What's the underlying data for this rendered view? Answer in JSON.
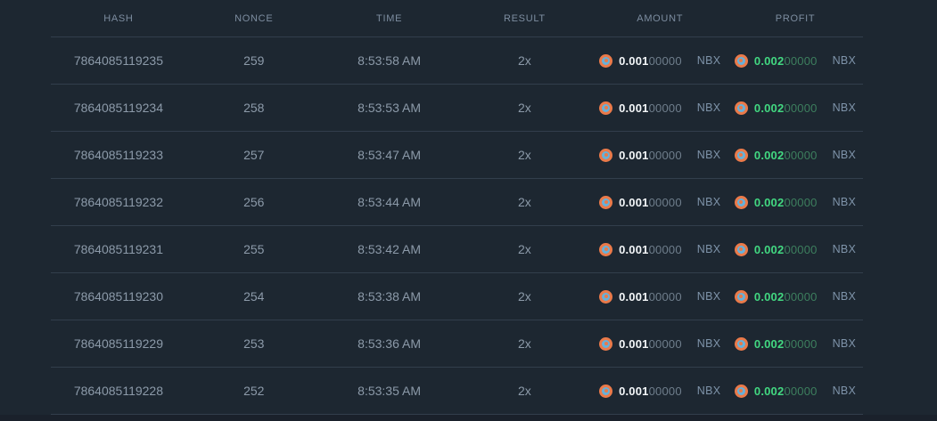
{
  "table": {
    "columns": [
      "HASH",
      "NONCE",
      "TIME",
      "RESULT",
      "AMOUNT",
      "PROFIT"
    ],
    "rows": [
      {
        "hash": "7864085119235",
        "nonce": "259",
        "time": "8:53:58 AM",
        "result": "2x",
        "amount_main": "0.001",
        "amount_rest": "00000",
        "amount_currency": "NBX",
        "profit_main": "0.002",
        "profit_rest": "00000",
        "profit_currency": "NBX"
      },
      {
        "hash": "7864085119234",
        "nonce": "258",
        "time": "8:53:53 AM",
        "result": "2x",
        "amount_main": "0.001",
        "amount_rest": "00000",
        "amount_currency": "NBX",
        "profit_main": "0.002",
        "profit_rest": "00000",
        "profit_currency": "NBX"
      },
      {
        "hash": "7864085119233",
        "nonce": "257",
        "time": "8:53:47 AM",
        "result": "2x",
        "amount_main": "0.001",
        "amount_rest": "00000",
        "amount_currency": "NBX",
        "profit_main": "0.002",
        "profit_rest": "00000",
        "profit_currency": "NBX"
      },
      {
        "hash": "7864085119232",
        "nonce": "256",
        "time": "8:53:44 AM",
        "result": "2x",
        "amount_main": "0.001",
        "amount_rest": "00000",
        "amount_currency": "NBX",
        "profit_main": "0.002",
        "profit_rest": "00000",
        "profit_currency": "NBX"
      },
      {
        "hash": "7864085119231",
        "nonce": "255",
        "time": "8:53:42 AM",
        "result": "2x",
        "amount_main": "0.001",
        "amount_rest": "00000",
        "amount_currency": "NBX",
        "profit_main": "0.002",
        "profit_rest": "00000",
        "profit_currency": "NBX"
      },
      {
        "hash": "7864085119230",
        "nonce": "254",
        "time": "8:53:38 AM",
        "result": "2x",
        "amount_main": "0.001",
        "amount_rest": "00000",
        "amount_currency": "NBX",
        "profit_main": "0.002",
        "profit_rest": "00000",
        "profit_currency": "NBX"
      },
      {
        "hash": "7864085119229",
        "nonce": "253",
        "time": "8:53:36 AM",
        "result": "2x",
        "amount_main": "0.001",
        "amount_rest": "00000",
        "amount_currency": "NBX",
        "profit_main": "0.002",
        "profit_rest": "00000",
        "profit_currency": "NBX"
      },
      {
        "hash": "7864085119228",
        "nonce": "252",
        "time": "8:53:35 AM",
        "result": "2x",
        "amount_main": "0.001",
        "amount_rest": "00000",
        "amount_currency": "NBX",
        "profit_main": "0.002",
        "profit_rest": "00000",
        "profit_currency": "NBX"
      }
    ]
  },
  "colors": {
    "page_bg": "#1d2731",
    "divider": "#323e4c",
    "header_text": "#7d8da0",
    "row_text": "#8c9aa9",
    "amount_white": "#f3f6f8",
    "dim_zeros": "#6f7e8c",
    "currency_text": "#7e93a9",
    "profit_green": "#42d881",
    "profit_green_dim": "#3d7f5e",
    "coin_orange": "#ea7a4a",
    "coin_blue": "#66b1da",
    "bottom_strip": "#1a212b"
  }
}
